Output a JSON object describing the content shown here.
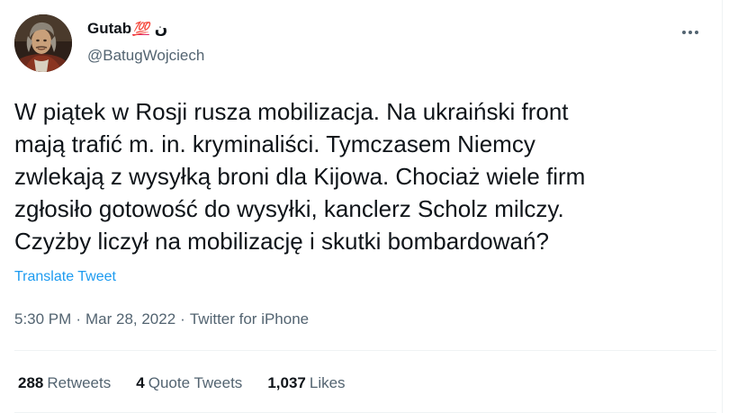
{
  "author": {
    "display_name": "Gutab",
    "name_emoji": "💯",
    "name_suffix": "ن",
    "handle": "@BatugWojciech",
    "avatar_icon": "portrait-avatar"
  },
  "tweet": {
    "text": "W piątek w Rosji rusza mobilizacja. Na ukraiński front\nmają trafić m. in. kryminaliści. Tymczasem Niemcy\nzwlekają z wysyłką broni dla Kijowa. Chociaż wiele firm\nzgłosiło gotowość do wysyłki, kanclerz Scholz milczy.\nCzyżby liczył na mobilizację i skutki bombardowań?",
    "translate_label": "Translate Tweet"
  },
  "meta": {
    "time": "5:30 PM",
    "separator": "·",
    "date": "Mar 28, 2022",
    "source": "Twitter for iPhone"
  },
  "stats": {
    "retweets_count": "288",
    "retweets_label": "Retweets",
    "quotes_count": "4",
    "quotes_label": "Quote Tweets",
    "likes_count": "1,037",
    "likes_label": "Likes"
  },
  "colors": {
    "link": "#1d9bf0",
    "secondary_text": "#536471",
    "primary_text": "#0f1419",
    "border": "#eff3f4"
  },
  "icons": {
    "more": "more-dots-icon"
  }
}
